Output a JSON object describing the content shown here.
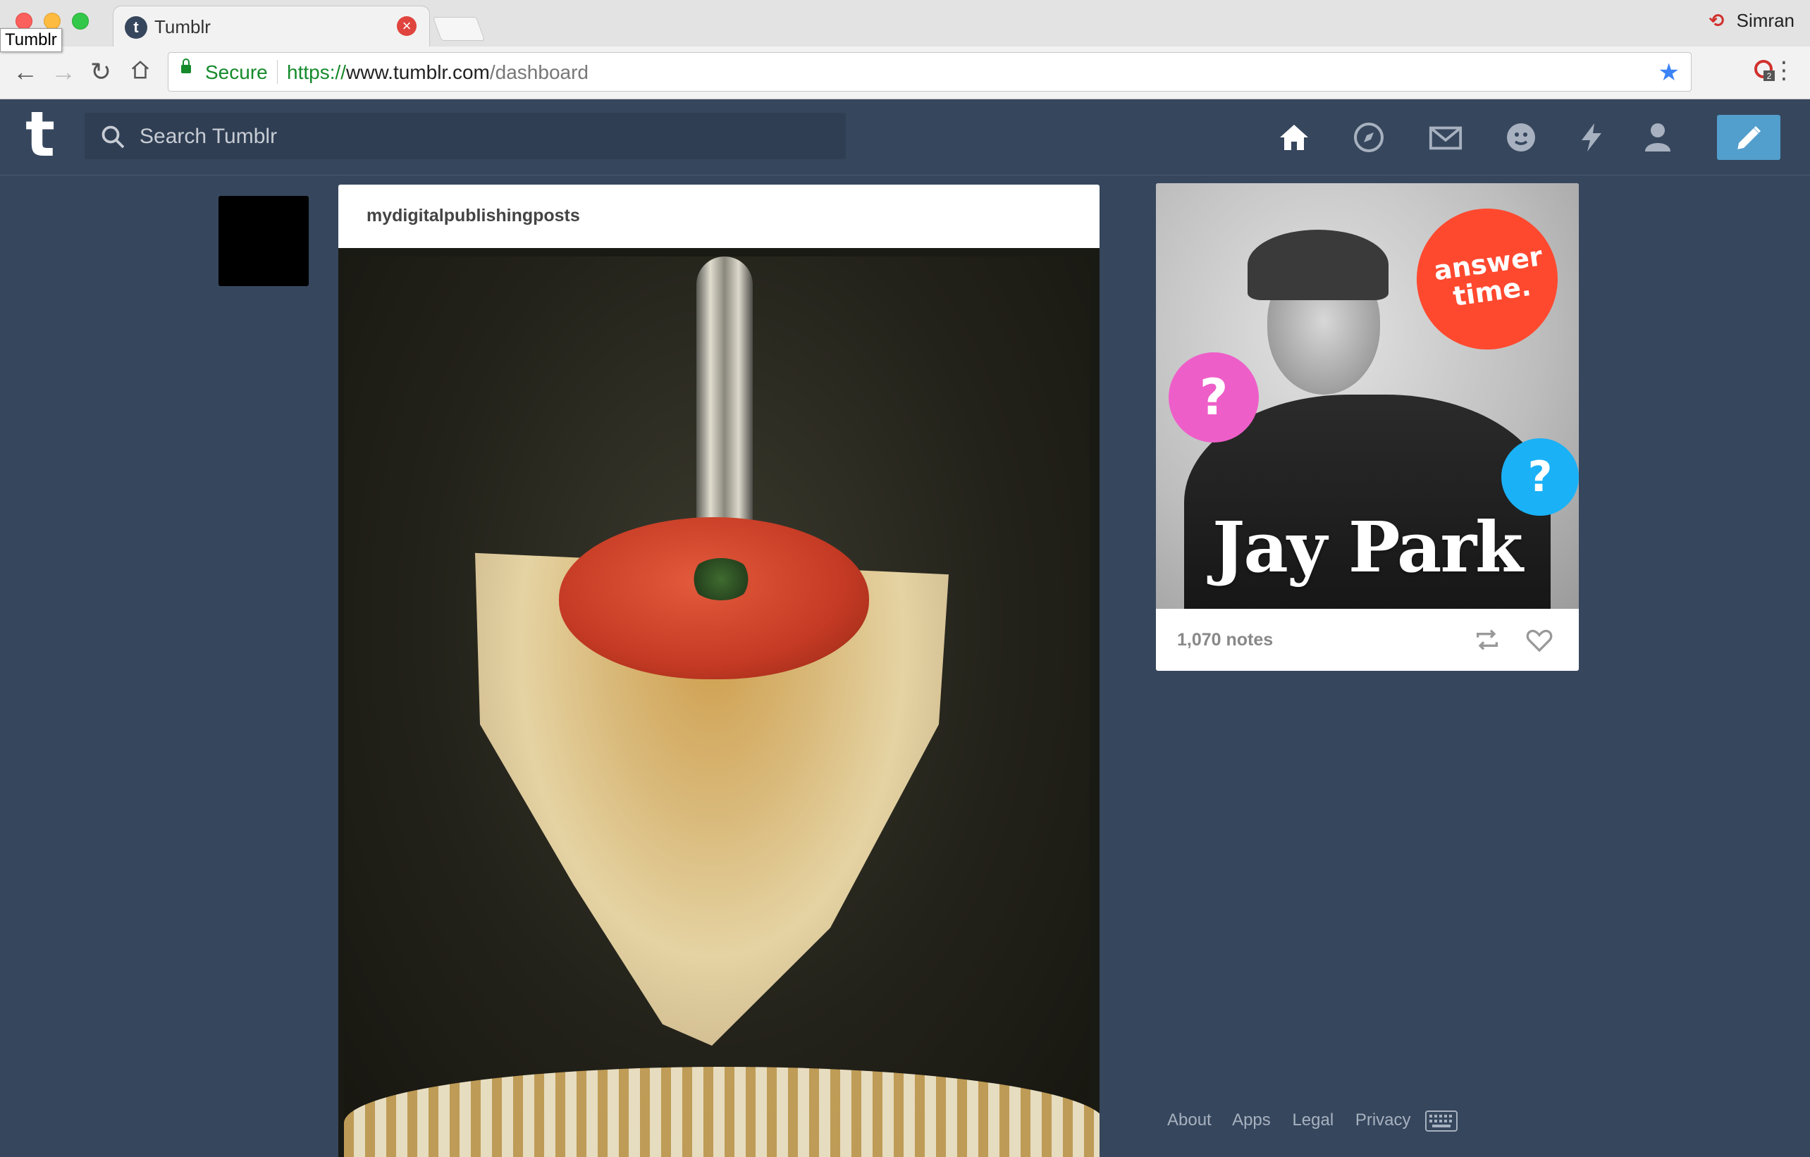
{
  "browser": {
    "tab_title": "Tumblr",
    "tooltip": "Tumblr",
    "profile_name": "Simran",
    "secure_label": "Secure",
    "url_scheme": "https://",
    "url_host": "www.tumblr.com",
    "url_path": "/dashboard",
    "extension_badge": "2"
  },
  "header": {
    "logo": "t",
    "search_placeholder": "Search Tumblr",
    "nav": [
      "home-icon",
      "explore-icon",
      "inbox-icon",
      "messaging-icon",
      "activity-icon",
      "account-icon"
    ],
    "compose_icon": "pencil-icon",
    "compose_color": "#529ecc"
  },
  "post": {
    "author": "mydigitalpublishingposts",
    "image_description": "quiche slice with tomato on a spoon above an ornate plate"
  },
  "radar": {
    "title": "Jay Park",
    "badge_line1": "answer",
    "badge_line2": "time.",
    "question_mark": "?",
    "notes": "1,070 notes"
  },
  "footer": {
    "links": [
      "About",
      "Apps",
      "Legal",
      "Privacy"
    ]
  },
  "colors": {
    "background": "#36465d",
    "accent": "#529ecc",
    "secure_green": "#168a2b"
  }
}
